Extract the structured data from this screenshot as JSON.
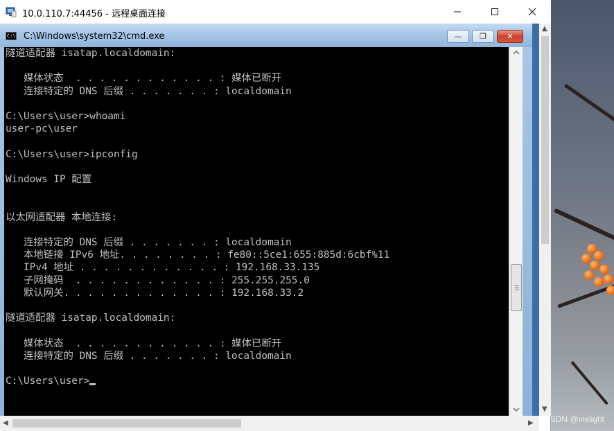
{
  "rdp": {
    "title": "10.0.110.7:44456 - 远程桌面连接",
    "minimize_icon": "minimize-icon",
    "maximize_icon": "maximize-icon",
    "close_icon": "close-icon"
  },
  "cmd": {
    "title": "C:\\Windows\\system32\\cmd.exe",
    "minimize_label": "—",
    "restore_label": "❐",
    "close_label": "✕",
    "lines": [
      "隧道适配器 isatap.localdomain:",
      "",
      "   媒体状态  . . . . . . . . . . . . : 媒体已断开",
      "   连接特定的 DNS 后缀 . . . . . . . : localdomain",
      "",
      "C:\\Users\\user>whoami",
      "user-pc\\user",
      "",
      "C:\\Users\\user>ipconfig",
      "",
      "Windows IP 配置",
      "",
      "",
      "以太网适配器 本地连接:",
      "",
      "   连接特定的 DNS 后缀 . . . . . . . : localdomain",
      "   本地链接 IPv6 地址. . . . . . . . : fe80::5ce1:655:885d:6cbf%11",
      "   IPv4 地址 . . . . . . . . . . . . : 192.168.33.135",
      "   子网掩码  . . . . . . . . . . . . : 255.255.255.0",
      "   默认网关. . . . . . . . . . . . . : 192.168.33.2",
      "",
      "隧道适配器 isatap.localdomain:",
      "",
      "   媒体状态  . . . . . . . . . . . . : 媒体已断开",
      "   连接特定的 DNS 后缀 . . . . . . . : localdomain",
      ""
    ],
    "prompt": "C:\\Users\\user>"
  },
  "watermark": "CSDN @inslight",
  "colors": {
    "console_bg": "#000000",
    "console_fg": "#c0c0c0",
    "cmd_frame": "#a4c4e6"
  }
}
